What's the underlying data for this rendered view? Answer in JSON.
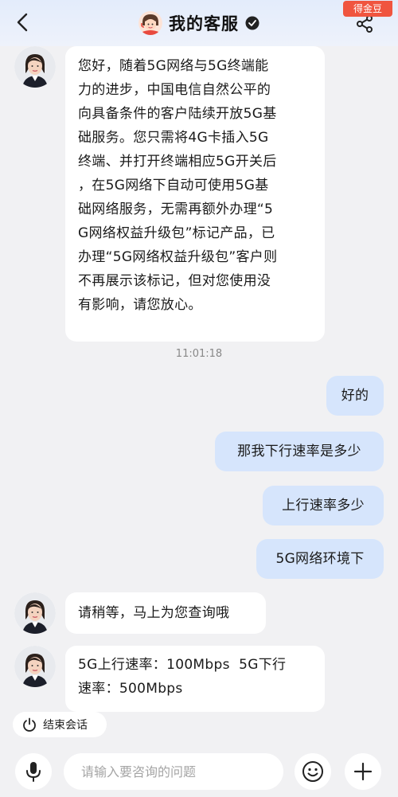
{
  "header": {
    "title": "我的客服",
    "coin_badge": "得金豆"
  },
  "messages": {
    "m1": "您好，随着5G网络与5G终端能力的进步，中国电信自然公平的向具备条件的客户陆续开放5G基础服务。您只需将4G卡插入5G终端、并打开终端相应5G开关后，在5G网络下自动可使用5G基础网络服务，无需再额外办理“5G网络权益升级包”标记产品，已办理“5G网络权益升级包”客户则不再展示该标记，但对您使用没有影响，请您放心。",
    "m1_lines": [
      "您好，随着5G网络与5G终端能",
      "力的进步，中国电信自然公平的",
      "向具备条件的客户陆续开放5G基",
      "础服务。您只需将4G卡插入5G",
      "终端、并打开终端相应5G开关后",
      "，在5G网络下自动可使用5G基",
      "础网络服务，无需再额外办理“5",
      "G网络权益升级包”标记产品，已",
      "办理“5G网络权益升级包”客户则",
      "不再展示该标记，但对您使用没",
      "有影响，请您放心。"
    ],
    "timestamp": "11:01:18",
    "u1": "好的",
    "u2": "那我下行速率是多少",
    "u3": "上行速率多少",
    "u4": "5G网络环境下",
    "m2": "请稍等，马上为您查询哦",
    "m3_line1": "5G上行速率：100Mbps  5G下行",
    "m3_line2": "速率：500Mbps"
  },
  "end_session": "结束会话",
  "input": {
    "placeholder": "请输入要咨询的问题",
    "value": ""
  },
  "icons": {
    "back": "back-arrow-icon",
    "verified": "verified-check-icon",
    "share": "share-icon",
    "power": "power-icon",
    "mic": "microphone-icon",
    "emoji": "emoji-icon",
    "plus": "plus-icon"
  },
  "colors": {
    "user_bubble": "#d6e5fc",
    "agent_bubble": "#ffffff",
    "background": "#f1f1f3",
    "badge": "#f0553f"
  }
}
